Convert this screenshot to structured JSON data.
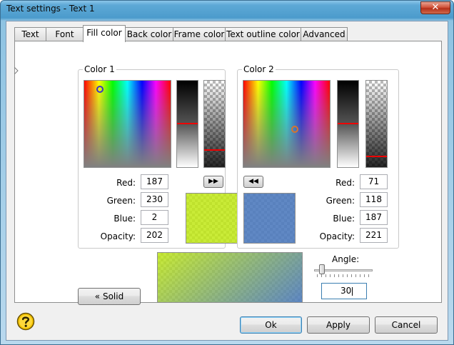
{
  "window": {
    "title": "Text settings - Text 1",
    "close_glyph": "✕"
  },
  "tabs": [
    {
      "label": "Text"
    },
    {
      "label": "Font"
    },
    {
      "label": "Fill color"
    },
    {
      "label": "Back color"
    },
    {
      "label": "Frame color"
    },
    {
      "label": "Text outline color"
    },
    {
      "label": "Advanced"
    }
  ],
  "active_tab": "Fill color",
  "color1": {
    "title": "Color 1",
    "red_label": "Red:",
    "red": "187",
    "green_label": "Green:",
    "green": "230",
    "blue_label": "Blue:",
    "blue": "2",
    "opacity_label": "Opacity:",
    "opacity": "202",
    "swatch_color": "#bbe602",
    "copy_button_glyph": "▶▶",
    "copy_button_icon": "double-right-arrow-icon"
  },
  "color2": {
    "title": "Color 2",
    "red_label": "Red:",
    "red": "71",
    "green_label": "Green:",
    "green": "118",
    "blue_label": "Blue:",
    "blue": "187",
    "opacity_label": "Opacity:",
    "opacity": "221",
    "swatch_color": "#4776bb",
    "copy_button_glyph": "◀◀",
    "copy_button_icon": "double-left-arrow-icon"
  },
  "solid_button": "« Solid",
  "angle": {
    "label": "Angle:",
    "value": "30"
  },
  "buttons": {
    "ok": "Ok",
    "apply": "Apply",
    "cancel": "Cancel"
  },
  "help_icon": "help-question-icon"
}
